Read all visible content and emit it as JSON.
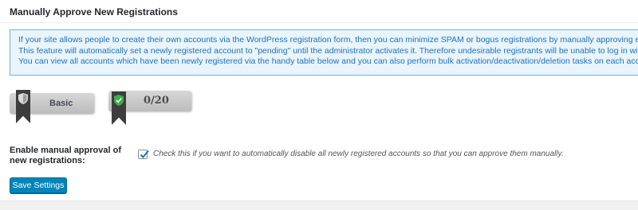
{
  "section": {
    "title": "Manually Approve New Registrations"
  },
  "info": {
    "lines": [
      "If your site allows people to create their own accounts via the WordPress registration form, then you can minimize SPAM or bogus registrations by manually approving each registration.",
      "This feature will automatically set a newly registered account to \"pending\" until the administrator activates it. Therefore undesirable registrants will be unable to log in without your express approval.",
      "You can view all accounts which have been newly registered via the handy table below and you can also perform bulk activation/deactivation/deletion tasks on each account."
    ]
  },
  "badges": {
    "level_label": "Basic",
    "score_label": "0/20"
  },
  "setting": {
    "label": "Enable manual approval of new registrations:",
    "checked": true,
    "description": "Check this if you want to automatically disable all newly registered accounts so that you can approve them manually."
  },
  "actions": {
    "save_label": "Save Settings"
  },
  "colors": {
    "accent": "#0085ba",
    "info_background": "#e9f4fb",
    "info_border": "#72aee6",
    "info_text": "#1e73be",
    "shield_green": "#3dae49"
  },
  "icons": {
    "level": "shield-icon",
    "score": "shield-check-icon",
    "checkbox": "checkmark-icon"
  }
}
